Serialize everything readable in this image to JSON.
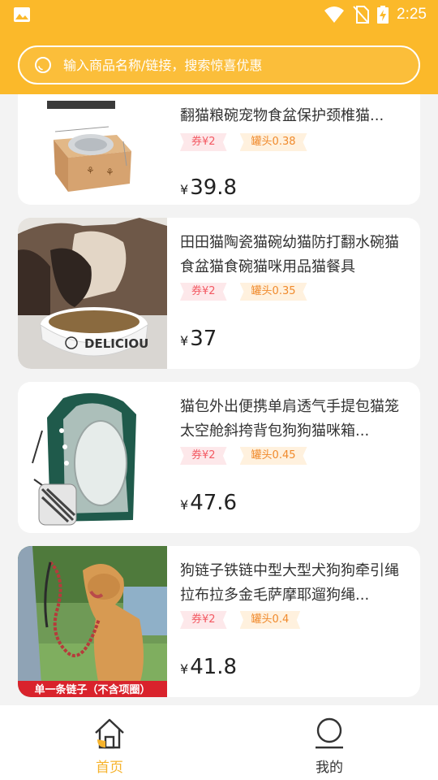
{
  "status_bar": {
    "time": "2:25"
  },
  "search": {
    "placeholder": "输入商品名称/链接，搜索惊喜优惠"
  },
  "products": [
    {
      "title": "翻猫粮碗宠物食盆保护颈椎猫...",
      "coupon": "券¥2",
      "cashback": "罐头0.38",
      "currency": "¥",
      "price": "39.8"
    },
    {
      "title": "田田猫陶瓷猫碗幼猫防打翻水碗猫食盆猫食碗猫咪用品猫餐具",
      "coupon": "券¥2",
      "cashback": "罐头0.35",
      "currency": "¥",
      "price": "37"
    },
    {
      "title": "猫包外出便携单肩透气手提包猫笼太空舱斜挎背包狗狗猫咪箱...",
      "coupon": "券¥2",
      "cashback": "罐头0.45",
      "currency": "¥",
      "price": "47.6"
    },
    {
      "title": "狗链子铁链中型大型犬狗狗牵引绳拉布拉多金毛萨摩耶遛狗绳...",
      "coupon": "券¥2",
      "cashback": "罐头0.4",
      "currency": "¥",
      "price": "41.8"
    }
  ],
  "images": {
    "bowl_text": "DELICIOU",
    "leash_banner": "单一条链子（不含项圈）"
  },
  "tab_bar": {
    "items": [
      {
        "label": "首页",
        "icon": "home-icon",
        "active": true
      },
      {
        "label": "我的",
        "icon": "profile-icon",
        "active": false
      }
    ]
  },
  "colors": {
    "brand": "#fbb92a",
    "active_tab": "#f6b32c",
    "coupon": "#f35a63",
    "cashback": "#f08a2c"
  }
}
